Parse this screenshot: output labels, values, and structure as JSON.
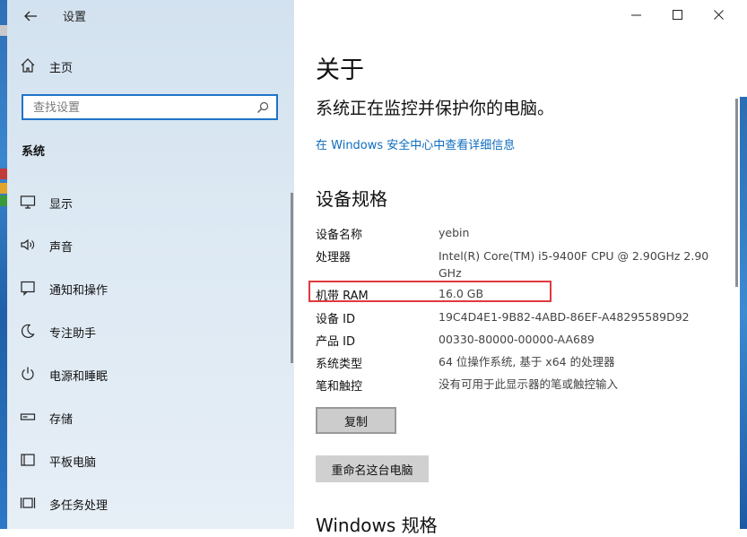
{
  "window": {
    "title": "设置"
  },
  "sidebar": {
    "home_label": "主页",
    "search_placeholder": "查找设置",
    "section": "系统",
    "items": [
      {
        "label": "显示",
        "icon": "monitor-icon"
      },
      {
        "label": "声音",
        "icon": "speaker-icon"
      },
      {
        "label": "通知和操作",
        "icon": "notification-icon"
      },
      {
        "label": "专注助手",
        "icon": "moon-icon"
      },
      {
        "label": "电源和睡眠",
        "icon": "power-icon"
      },
      {
        "label": "存储",
        "icon": "storage-icon"
      },
      {
        "label": "平板电脑",
        "icon": "tablet-icon"
      },
      {
        "label": "多任务处理",
        "icon": "multitask-icon"
      }
    ]
  },
  "main": {
    "heading": "关于",
    "subheading": "系统正在监控并保护你的电脑。",
    "security_link": "在 Windows 安全中心中查看详细信息",
    "specs_heading": "设备规格",
    "specs": [
      {
        "key": "设备名称",
        "value": "yebin"
      },
      {
        "key": "处理器",
        "value": "Intel(R) Core(TM) i5-9400F CPU @ 2.90GHz   2.90 GHz"
      },
      {
        "key": "机带 RAM",
        "value": "16.0 GB"
      },
      {
        "key": "设备 ID",
        "value": "19C4D4E1-9B82-4ABD-86EF-A48295589D92"
      },
      {
        "key": "产品 ID",
        "value": "00330-80000-00000-AA689"
      },
      {
        "key": "系统类型",
        "value": "64 位操作系统, 基于 x64 的处理器"
      },
      {
        "key": "笔和触控",
        "value": "没有可用于此显示器的笔或触控输入"
      }
    ],
    "copy_button": "复制",
    "rename_button": "重命名这台电脑",
    "windows_specs_heading": "Windows 规格"
  },
  "colors": {
    "accent": "#0f6cbd",
    "highlight": "#e0393e",
    "sidebar_bg": "#dde9f3"
  }
}
